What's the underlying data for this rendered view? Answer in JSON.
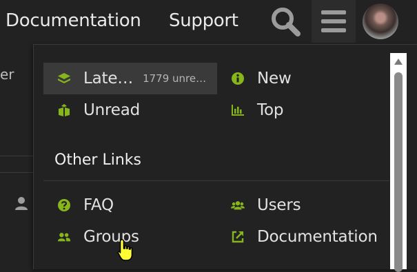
{
  "header": {
    "nav_links": [
      "Documentation",
      "Support"
    ],
    "search_label": "Search",
    "menu_label": "Menu",
    "avatar_label": "User avatar"
  },
  "background_page": {
    "fragment_text": "er"
  },
  "dropdown": {
    "items": [
      {
        "label": "Late…",
        "sub": "1779 unre…",
        "icon": "layers-icon",
        "active": true
      },
      {
        "label": "New",
        "icon": "info-circle-icon"
      },
      {
        "label": "Unread",
        "icon": "box-icon"
      },
      {
        "label": "Top",
        "icon": "bar-chart-icon"
      }
    ],
    "section_title": "Other Links",
    "links": [
      {
        "label": "FAQ",
        "icon": "question-circle-icon"
      },
      {
        "label": "Users",
        "icon": "users-icon"
      },
      {
        "label": "Groups",
        "icon": "user-group-icon"
      },
      {
        "label": "Documentation",
        "icon": "external-link-icon"
      }
    ]
  },
  "colors": {
    "accent": "#86b51c",
    "background": "#222222",
    "active_item": "#3a3a3a",
    "text": "#e2e2e2"
  }
}
